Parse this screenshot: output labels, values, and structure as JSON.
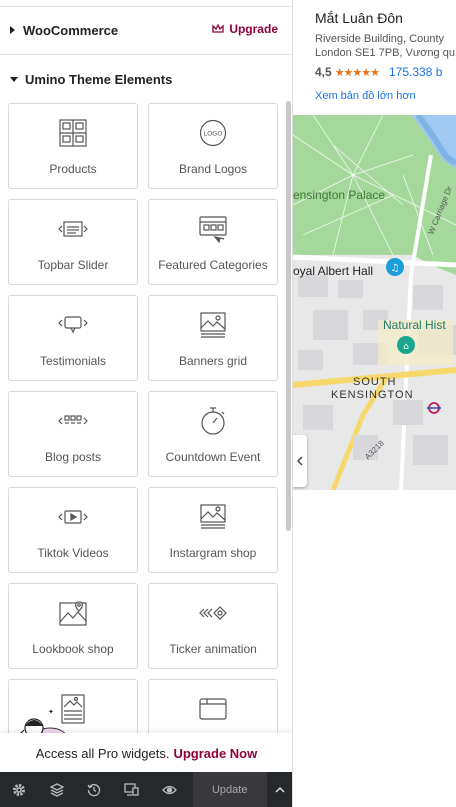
{
  "panel": {
    "woocommerce_category": {
      "title": "WooCommerce",
      "upgrade_label": "Upgrade"
    },
    "theme_category": {
      "title": "Umino Theme Elements"
    },
    "widgets": [
      {
        "label": "Products",
        "icon": "products-grid-icon"
      },
      {
        "label": "Brand Logos",
        "icon": "brand-logo-icon"
      },
      {
        "label": "Topbar Slider",
        "icon": "topbar-slider-icon"
      },
      {
        "label": "Featured Categories",
        "icon": "featured-categories-icon"
      },
      {
        "label": "Testimonials",
        "icon": "testimonials-icon"
      },
      {
        "label": "Banners grid",
        "icon": "banners-grid-icon"
      },
      {
        "label": "Blog posts",
        "icon": "blog-posts-icon"
      },
      {
        "label": "Countdown Event",
        "icon": "stopwatch-icon"
      },
      {
        "label": "Tiktok Videos",
        "icon": "video-icon"
      },
      {
        "label": "Instargram shop",
        "icon": "instagram-shop-icon"
      },
      {
        "label": "Lookbook shop",
        "icon": "lookbook-map-icon"
      },
      {
        "label": "Ticker animation",
        "icon": "ticker-icon"
      },
      {
        "label": "",
        "icon": "image-list-icon"
      },
      {
        "label": "",
        "icon": "folder-icon"
      }
    ],
    "promo": {
      "text": "Access all Pro widgets.",
      "cta": "Upgrade Now"
    },
    "toolbar": {
      "update_label": "Update"
    }
  },
  "map": {
    "place_title": "Mắt Luân Đôn",
    "address_line1": "Riverside Building, County",
    "address_line2": "London SE1 7PB, Vương qu",
    "rating": "4,5",
    "stars": "★★★★★",
    "reviews": "175.338 b",
    "larger_map_link": "Xem bản đồ lớn hơn",
    "labels": {
      "kensington_palace": "ensington Palace",
      "royal_albert_hall": "oyal Albert Hall",
      "natural_history": "Natural Hist",
      "south_kensington_1": "SOUTH",
      "south_kensington_2": "KENSINGTON",
      "carriage_dr": "W Carriage Dr",
      "road_a3218": "A3218"
    }
  },
  "colors": {
    "accent": "#92003b",
    "link": "#1a73e8",
    "toolbar": "#26292c",
    "park": "#a5d89b"
  }
}
